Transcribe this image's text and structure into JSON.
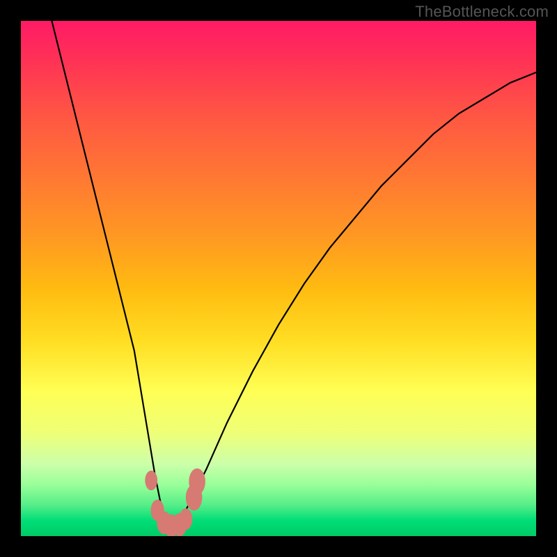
{
  "watermark": "TheBottleneck.com",
  "chart_data": {
    "type": "line",
    "title": "",
    "xlabel": "",
    "ylabel": "",
    "xlim": [
      0,
      100
    ],
    "ylim": [
      0,
      100
    ],
    "grid": false,
    "legend": false,
    "note": "Axes are unlabeled in the source image; x and y are normalized 0–100 to the plot box. The curve is a V-shaped dip whose minimum sits near x≈29 at y≈2; it rises steeply toward y=100 on the left edge and more gradually toward y≈90 on the right edge.",
    "series": [
      {
        "name": "bottleneck-curve",
        "x": [
          6,
          8,
          10,
          12,
          14,
          16,
          18,
          20,
          22,
          24,
          25,
          26,
          27,
          28,
          29,
          30,
          31,
          32,
          33,
          34,
          36,
          40,
          45,
          50,
          55,
          60,
          65,
          70,
          75,
          80,
          85,
          90,
          95,
          100
        ],
        "y": [
          100,
          92,
          84,
          76,
          68,
          60,
          52,
          44,
          36,
          24,
          18,
          12,
          7,
          3,
          2,
          2,
          3,
          5,
          7,
          9,
          13,
          22,
          32,
          41,
          49,
          56,
          62,
          68,
          73,
          78,
          82,
          85,
          88,
          90
        ]
      }
    ],
    "markers": {
      "note": "Salmon-colored data points clustered around the trough.",
      "points": [
        {
          "x": 25.3,
          "y": 10.8,
          "r": 1.2
        },
        {
          "x": 26.5,
          "y": 5.0,
          "r": 1.3
        },
        {
          "x": 27.8,
          "y": 2.6,
          "r": 1.4
        },
        {
          "x": 29.2,
          "y": 2.0,
          "r": 1.4
        },
        {
          "x": 30.8,
          "y": 2.2,
          "r": 1.4
        },
        {
          "x": 32.0,
          "y": 3.3,
          "r": 1.3
        },
        {
          "x": 33.6,
          "y": 7.5,
          "r": 1.6
        },
        {
          "x": 34.2,
          "y": 10.6,
          "r": 1.6
        }
      ]
    }
  }
}
